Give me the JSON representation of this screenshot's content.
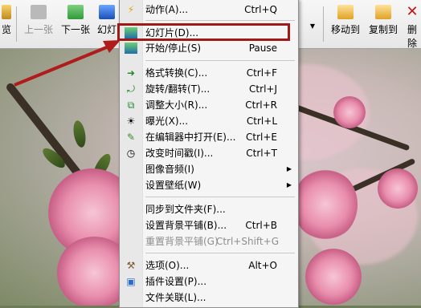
{
  "toolbar": {
    "items": [
      {
        "label": "览",
        "icon": "browse-icon",
        "enabled": true
      },
      {
        "label": "上一张",
        "icon": "previous-icon",
        "enabled": false
      },
      {
        "label": "下一张",
        "icon": "next-icon",
        "enabled": true
      },
      {
        "label": "幻灯",
        "icon": "slideshow-icon",
        "enabled": true
      },
      {
        "label": "移动到",
        "icon": "move-to-icon",
        "enabled": true
      },
      {
        "label": "复制到",
        "icon": "copy-to-icon",
        "enabled": true
      },
      {
        "label": "删除",
        "icon": "delete-icon",
        "enabled": true
      }
    ]
  },
  "menu": {
    "items": [
      {
        "label": "动作(A)...",
        "shortcut": "Ctrl+Q",
        "icon": "lightning-icon"
      },
      {
        "label": "幻灯片(D)...",
        "shortcut": "",
        "icon": "slideshow-icon",
        "highlighted": true
      },
      {
        "label": "开始/停止(S)",
        "shortcut": "Pause",
        "icon": "start-stop-icon"
      },
      {
        "label": "格式转换(C)...",
        "shortcut": "Ctrl+F",
        "icon": "convert-icon"
      },
      {
        "label": "旋转/翻转(T)...",
        "shortcut": "Ctrl+J",
        "icon": "rotate-icon"
      },
      {
        "label": "调整大小(R)...",
        "shortcut": "Ctrl+R",
        "icon": "resize-icon"
      },
      {
        "label": "曝光(X)...",
        "shortcut": "Ctrl+L",
        "icon": "exposure-icon"
      },
      {
        "label": "在编辑器中打开(E)...",
        "shortcut": "Ctrl+E",
        "icon": "edit-icon"
      },
      {
        "label": "改变时间戳(I)...",
        "shortcut": "Ctrl+T",
        "icon": "clock-icon"
      },
      {
        "label": "图像音频(I)",
        "shortcut": "",
        "icon": "",
        "submenu": true
      },
      {
        "label": "设置壁纸(W)",
        "shortcut": "",
        "icon": "",
        "submenu": true
      },
      {
        "label": "同步到文件夹(F)...",
        "shortcut": "",
        "icon": ""
      },
      {
        "label": "设置背景平铺(B)...",
        "shortcut": "Ctrl+B",
        "icon": ""
      },
      {
        "label": "重置背景平铺(G)",
        "shortcut": "Ctrl+Shift+G",
        "icon": "",
        "disabled": true
      },
      {
        "label": "选项(O)...",
        "shortcut": "Alt+O",
        "icon": "tools-icon"
      },
      {
        "label": "插件设置(P)...",
        "shortcut": "",
        "icon": "plugin-icon"
      },
      {
        "label": "文件关联(L)...",
        "shortcut": "",
        "icon": ""
      }
    ]
  },
  "colors": {
    "highlight_box": "#a01818",
    "arrow": "#b01c1c"
  }
}
